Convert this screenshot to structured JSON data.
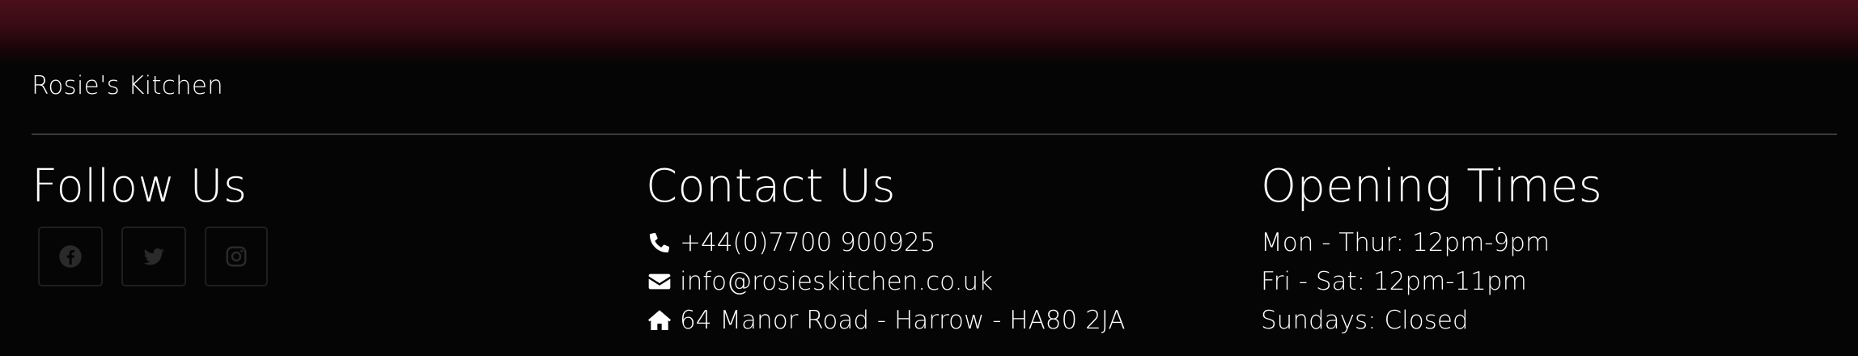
{
  "brand": {
    "name": "Rosie's Kitchen"
  },
  "follow": {
    "heading": "Follow Us",
    "socials": [
      {
        "icon": "facebook-icon"
      },
      {
        "icon": "twitter-icon"
      },
      {
        "icon": "instagram-icon"
      }
    ]
  },
  "contact": {
    "heading": "Contact Us",
    "phone": "+44(0)7700 900925",
    "email": "info@rosieskitchen.co.uk",
    "address": "64 Manor Road - Harrow - HA80 2JA"
  },
  "hours": {
    "heading": "Opening Times",
    "lines": [
      "Mon - Thur: 12pm-9pm",
      "Fri - Sat: 12pm-11pm",
      "Sundays: Closed"
    ]
  },
  "colors": {
    "top_gradient": "#4a0f1a",
    "background": "#050505",
    "divider": "#3a3a3a",
    "social_icon": "#2a2a2a"
  }
}
